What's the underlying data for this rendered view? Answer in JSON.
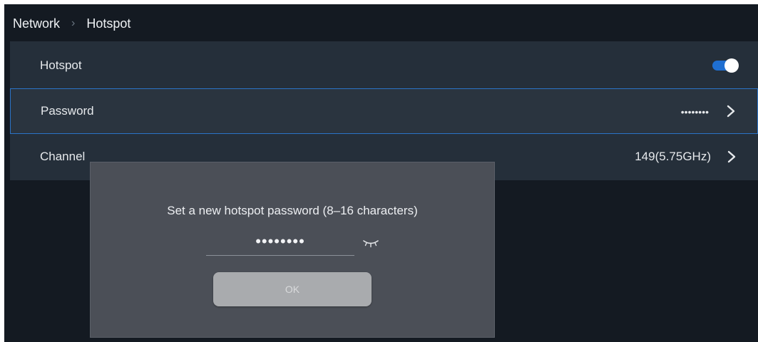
{
  "breadcrumb": {
    "parent": "Network",
    "separator": "›",
    "current": "Hotspot"
  },
  "settings": {
    "hotspot": {
      "label": "Hotspot",
      "enabled": true
    },
    "password": {
      "label": "Password",
      "value": "••••••••"
    },
    "channel": {
      "label": "Channel",
      "value": "149(5.75GHz)"
    }
  },
  "dialog": {
    "prompt": "Set a new hotspot password (8–16 characters)",
    "password_value": "••••••••",
    "ok_label": "OK"
  },
  "icons": {
    "chevron": "chevron-right-icon",
    "eye": "eye-closed-icon"
  },
  "colors": {
    "accent": "#1f6fd1",
    "selection_border": "#2b74c8"
  }
}
